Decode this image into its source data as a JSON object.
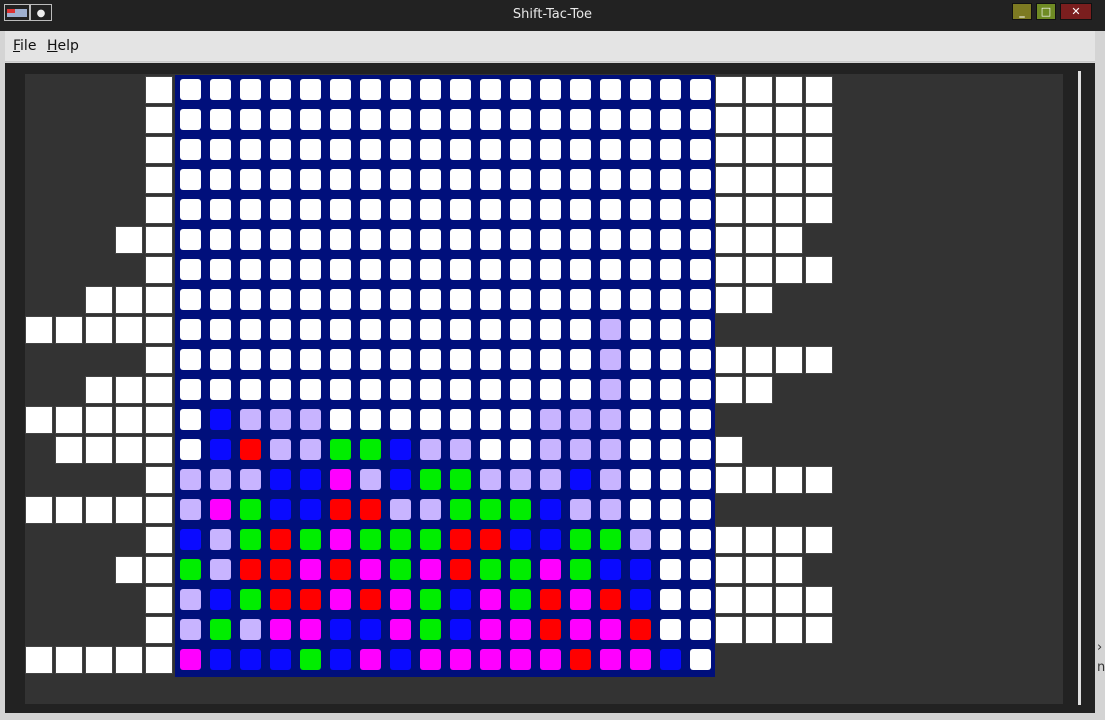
{
  "window": {
    "title": "Shift-Tac-Toe",
    "controls": {
      "minimize_icon": "minimize-icon",
      "maximize_icon": "maximize-icon",
      "close_icon": "close-icon"
    }
  },
  "menu": [
    {
      "accel": "F",
      "rest": "ile"
    },
    {
      "accel": "H",
      "rest": "elp"
    }
  ],
  "colors": {
    "W": "#ffffff",
    "L": "#c8b4ff",
    "B": "#0a0aff",
    "G": "#00ee00",
    "R": "#ff0000",
    "M": "#ff00ff",
    "board": "#000f7b",
    "background": "#333333"
  },
  "board": {
    "columns": 18,
    "rows": [
      "WWWWWWWWWWWWWWWWWW",
      "WWWWWWWWWWWWWWWWWW",
      "WWWWWWWWWWWWWWWWWW",
      "WWWWWWWWWWWWWWWWWW",
      "WWWWWWWWWWWWWWWWWW",
      "WWWWWWWWWWWWWWWWWW",
      "WWWWWWWWWWWWWWWWWW",
      "WWWWWWWWWWWWWWWWWW",
      "WWWWWWWWWWWWWWLWWW",
      "WWWWWWWWWWWWWWLWWW",
      "WWWWWWWWWWWWWWLWWW",
      "WBLLLWWWWWWWLLLWWW",
      "WBRLLGGBLLWWLLLWWW",
      "LLLBBMLBGGLLLBLWWW",
      "LMGBBRRLLGGGBLLWWW",
      "BLGRGMGGGRRBBGGLWW",
      "GLRRMRMGMRGGMGBBWW",
      "LBGRRMRMGBMGRMRBWW",
      "LGLMMBBMGBMMRMMRWW",
      "MBBBGBMBMMMMMRMMBW"
    ]
  },
  "left_strips": [
    1,
    1,
    1,
    1,
    1,
    2,
    1,
    3,
    5,
    1,
    3,
    5,
    4,
    1,
    5,
    1,
    2,
    1,
    1,
    5
  ],
  "right_strips": [
    4,
    4,
    4,
    4,
    4,
    3,
    4,
    2,
    0,
    4,
    2,
    0,
    1,
    4,
    0,
    4,
    3,
    4,
    4,
    0
  ]
}
